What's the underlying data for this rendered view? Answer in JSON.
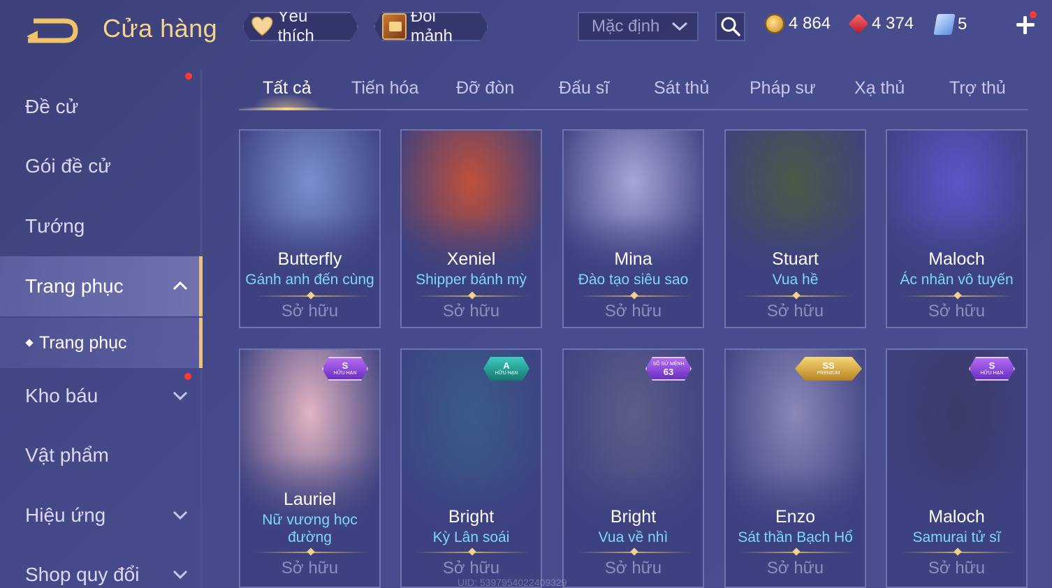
{
  "header": {
    "title": "Cửa hàng",
    "favorites_label": "Yêu thích",
    "fragments_label": "Đổi mảnh",
    "sort_value": "Mặc định",
    "currencies": {
      "gold": "4 864",
      "ruby": "4 374",
      "voucher": "5"
    }
  },
  "sidebar": {
    "items": [
      {
        "label": "Đề cử"
      },
      {
        "label": "Gói đề cử"
      },
      {
        "label": "Tướng"
      },
      {
        "label": "Trang phục"
      },
      {
        "label": "Kho báu"
      },
      {
        "label": "Vật phẩm"
      },
      {
        "label": "Hiệu ứng"
      },
      {
        "label": "Shop quy đổi"
      }
    ],
    "sub_item": "Trang phục"
  },
  "tabs": [
    "Tất cả",
    "Tiến hóa",
    "Đỡ đòn",
    "Đấu sĩ",
    "Sát thủ",
    "Pháp sư",
    "Xạ thủ",
    "Trợ thủ"
  ],
  "cards": [
    {
      "hero": "Butterfly",
      "skin": "Gánh anh đến cùng",
      "status": "Sở hữu",
      "color": "#7a8fd0"
    },
    {
      "hero": "Xeniel",
      "skin": "Shipper bánh mỳ",
      "status": "Sở hữu",
      "color": "#c0503a"
    },
    {
      "hero": "Mina",
      "skin": "Đào tạo siêu sao",
      "status": "Sở hữu",
      "color": "#a7a6d8"
    },
    {
      "hero": "Stuart",
      "skin": "Vua hề",
      "status": "Sở hữu",
      "color": "#4a5a48"
    },
    {
      "hero": "Maloch",
      "skin": "Ác nhân vô tuyến",
      "status": "Sở hữu",
      "color": "#5a56c8"
    },
    {
      "hero": "Lauriel",
      "skin": "Nữ vương học đường",
      "status": "Sở hữu",
      "color": "#e2b4c2",
      "badge_tier": "S",
      "badge_sub": "HỮU HẠN",
      "badge_color": "purple"
    },
    {
      "hero": "Bright",
      "skin": "Kỳ Lân soái",
      "status": "Sở hữu",
      "color": "#3a5c8a",
      "badge_tier": "A",
      "badge_sub": "HỮU HẠN",
      "badge_color": "teal"
    },
    {
      "hero": "Bright",
      "skin": "Vua về nhì",
      "status": "Sở hữu",
      "color": "#5c5e88",
      "badge_tier": "63",
      "badge_sub": "SỐ SỨ MỆNH",
      "badge_color": "purple"
    },
    {
      "hero": "Enzo",
      "skin": "Sát thần Bạch Hổ",
      "status": "Sở hữu",
      "color": "#8a88b8",
      "badge_tier": "SS",
      "badge_sub": "PREMIUM",
      "badge_color": "gold"
    },
    {
      "hero": "Maloch",
      "skin": "Samurai tử sĩ",
      "status": "Sở hữu",
      "color": "#3c3c6a",
      "badge_tier": "S",
      "badge_sub": "HỮU HẠN",
      "badge_color": "purple"
    }
  ],
  "footer": {
    "uid": "UID: 5397954022409329"
  }
}
